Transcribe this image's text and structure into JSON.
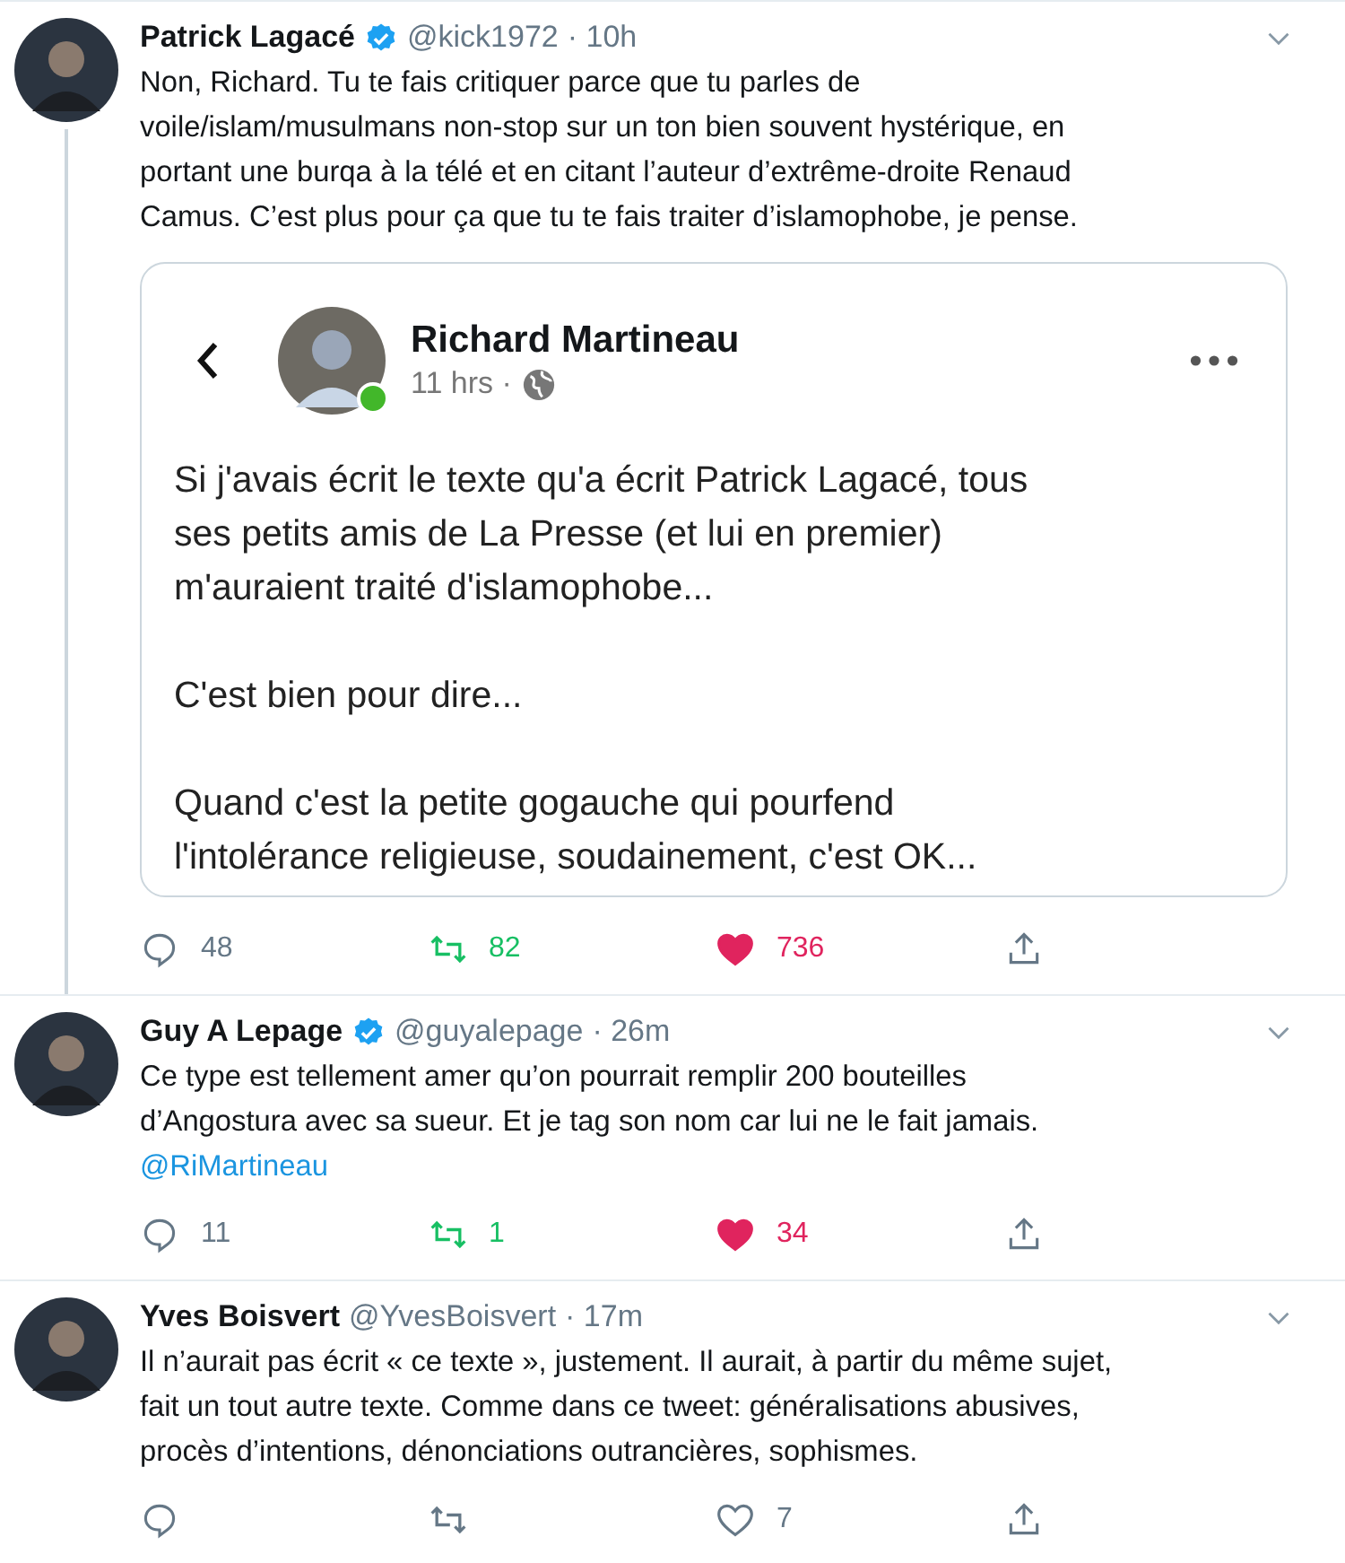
{
  "tweets": [
    {
      "name": "Patrick Lagacé",
      "verified": true,
      "handle": "@kick1972",
      "time": "· 10h",
      "text": "Non, Richard. Tu te fais critiquer parce que tu parles de\nvoile/islam/musulmans non-stop sur un ton bien souvent hystérique, en\nportant une burqa à la télé et en citant l’auteur d’extrême-droite Renaud\nCamus. C’est plus pour ça que tu te fais traiter d’islamophobe, je pense.",
      "thread": true,
      "embed": {
        "name": "Richard Martineau",
        "time": "11 hrs ·",
        "online": true,
        "paragraphs": [
          "Si j'avais écrit le texte qu'a écrit Patrick Lagacé, tous\nses petits amis de La Presse (et lui en premier)\nm'auraient traité d'islamophobe...",
          "C'est bien pour dire...",
          "Quand c'est la petite gogauche qui pourfend\nl'intolérance religieuse, soudainement, c'est OK..."
        ]
      },
      "replies": "48",
      "retweets": "82",
      "retweeted": true,
      "likes": "736",
      "liked": true
    },
    {
      "name": "Guy A Lepage",
      "verified": true,
      "handle": "@guyalepage",
      "time": "· 26m",
      "text": "Ce type est tellement amer qu’on pourrait remplir 200 bouteilles\nd’Angostura avec sa sueur. Et je tag son nom car lui ne le fait jamais.",
      "mention": "@RiMartineau",
      "thread": false,
      "replies": "11",
      "retweets": "1",
      "retweeted": true,
      "likes": "34",
      "liked": true
    },
    {
      "name": "Yves Boisvert",
      "verified": false,
      "handle": "@YvesBoisvert",
      "time": "· 17m",
      "text": "Il n’aurait pas écrit « ce texte », justement. Il aurait, à partir du même sujet,\nfait un tout autre texte. Comme dans ce tweet: généralisations abusives,\nprocès d’intentions, dénonciations outrancières, sophismes.",
      "thread": false,
      "likes": "7",
      "retweeted": false,
      "liked": false
    }
  ]
}
